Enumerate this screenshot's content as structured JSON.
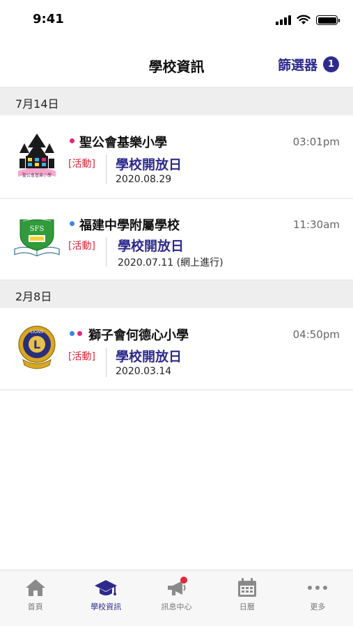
{
  "status_bar": {
    "time": "9:41"
  },
  "header": {
    "title": "學校資訊",
    "filter_label": "篩選器",
    "filter_count": "1"
  },
  "sections": [
    {
      "date": "7月14日",
      "items": [
        {
          "school": "聖公會基樂小學",
          "time": "03:01pm",
          "tag": "[活動]",
          "event": "學校開放日",
          "event_date": "2020.08.29",
          "dot_colors": [
            "#e8237f"
          ],
          "logo_caption": "聖公會基樂小學",
          "logo_icon": "church-tower-logo"
        },
        {
          "school": "福建中學附屬學校",
          "time": "11:30am",
          "tag": "[活動]",
          "event": "學校開放日",
          "event_date": "2020.07.11 (網上進行)",
          "dot_colors": [
            "#3a86e8"
          ],
          "logo_text": "SFS",
          "logo_icon": "shield-book-logo"
        }
      ]
    },
    {
      "date": "2月8日",
      "items": [
        {
          "school": "獅子會何德心小學",
          "time": "04:50pm",
          "tag": "[活動]",
          "event": "學校開放日",
          "event_date": "2020.03.14",
          "dot_colors": [
            "#3a86e8",
            "#e8237f"
          ],
          "logo_text": "LIONS",
          "logo_letter": "L",
          "logo_icon": "lions-emblem-logo"
        }
      ]
    }
  ],
  "tab_bar": {
    "tabs": [
      {
        "label": "首頁",
        "icon": "home-icon"
      },
      {
        "label": "學校資訊",
        "icon": "graduation-cap-icon"
      },
      {
        "label": "訊息中心",
        "icon": "megaphone-icon"
      },
      {
        "label": "日曆",
        "icon": "calendar-icon"
      },
      {
        "label": "更多",
        "icon": "more-dots-icon"
      }
    ],
    "active_index": 1
  },
  "colors": {
    "accent": "#2e2a8c",
    "tag_red": "#e0243a",
    "section_bg": "#eeeeee",
    "inactive_icon": "#8a8a8a",
    "notification": "#e8253a"
  }
}
